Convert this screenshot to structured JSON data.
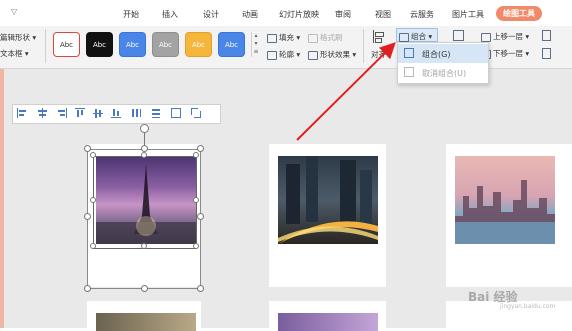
{
  "menu": {
    "collapse_arrow": "▽",
    "items": [
      "开始",
      "插入",
      "设计",
      "动画",
      "幻灯片放映",
      "审阅",
      "视图",
      "云服务",
      "图片工具"
    ],
    "active": "绘图工具"
  },
  "ribbon": {
    "left": {
      "shape_label": "篇辑形状",
      "textbox_label": "文本框"
    },
    "style_swatch_text": "Abc",
    "swatches": [
      {
        "bg": "#ffffff",
        "border": "#d9473f",
        "fg": "#333333"
      },
      {
        "bg": "#111111",
        "border": "#111111",
        "fg": "#ffffff"
      },
      {
        "bg": "#4a86e8",
        "border": "#3a74d4",
        "fg": "#ffffff"
      },
      {
        "bg": "#a3a3a3",
        "border": "#8e8e8e",
        "fg": "#ffffff"
      },
      {
        "bg": "#f5b63c",
        "border": "#e2a22a",
        "fg": "#ffffff"
      },
      {
        "bg": "#4a86e8",
        "border": "#3a74d4",
        "fg": "#ffffff"
      }
    ],
    "fill_label": "填充",
    "outline_label": "轮廓",
    "text_effect_label": "格式刷",
    "shape_effect_label": "形状效果",
    "align_label": "对齐",
    "group_label": "组合",
    "bring_forward_label": "上移一层",
    "send_backward_label": "下移一层"
  },
  "dropdown": {
    "group_item": "组合(G)",
    "ungroup_item": "取消组合(U)"
  },
  "watermark": {
    "text": "Bai 经验",
    "sub": "jingyan.baidu.com"
  },
  "colors": {
    "accent": "#f08a68",
    "arrow": "#e02020",
    "canvas": "#e9e9e9"
  },
  "align_tools": [
    "align-left-icon",
    "align-center-icon",
    "align-right-icon",
    "align-top-icon",
    "align-middle-icon",
    "align-bottom-icon",
    "distribute-horizontal-icon",
    "distribute-vertical-icon",
    "same-size-icon",
    "group-icon"
  ]
}
